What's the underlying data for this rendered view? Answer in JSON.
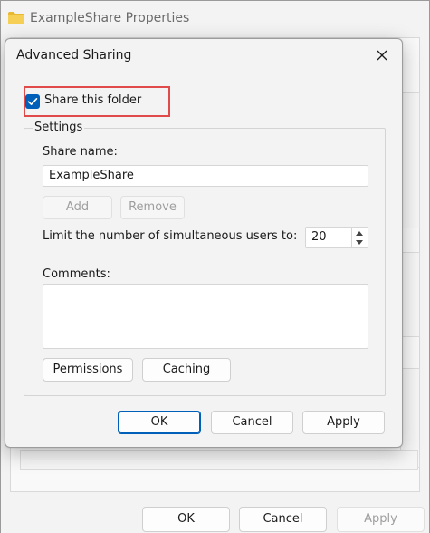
{
  "background_window": {
    "title": "ExampleShare Properties",
    "buttons": {
      "ok": "OK",
      "cancel": "Cancel",
      "apply": "Apply"
    }
  },
  "dialog": {
    "title": "Advanced Sharing",
    "share_checkbox": {
      "label": "Share this folder",
      "checked": true
    },
    "settings": {
      "legend": "Settings",
      "share_name_label": "Share name:",
      "share_name_value": "ExampleShare",
      "add_label": "Add",
      "remove_label": "Remove",
      "limit_label": "Limit the number of simultaneous users to:",
      "limit_value": "20",
      "comments_label": "Comments:",
      "comments_value": "",
      "permissions_label": "Permissions",
      "caching_label": "Caching"
    },
    "buttons": {
      "ok": "OK",
      "cancel": "Cancel",
      "apply": "Apply"
    }
  },
  "icons": {
    "folder": "folder-icon",
    "close": "close-icon",
    "check": "checkmark-icon",
    "spin_up": "chevron-up-icon",
    "spin_down": "chevron-down-icon"
  },
  "colors": {
    "accent": "#005fb8",
    "highlight_border": "#e04a4a",
    "folder": "#f2c94c"
  }
}
